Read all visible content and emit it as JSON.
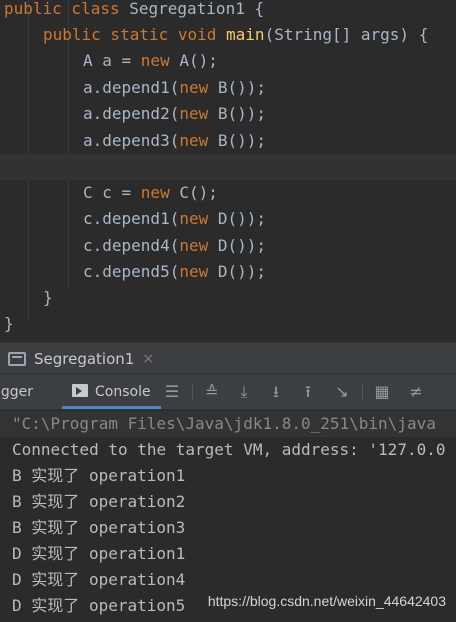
{
  "editor": {
    "lines": [
      {
        "kw1": "public class ",
        "t1": "Segregation1 {"
      },
      {
        "kw1": "public static void ",
        "fn": "main",
        "t1": "(String[] args) {"
      },
      {
        "t1": "A a = ",
        "kw1": "new ",
        "t2": "A();"
      },
      {
        "t1": "a.depend1(",
        "kw1": "new ",
        "t2": "B());"
      },
      {
        "t1": "a.depend2(",
        "kw1": "new ",
        "t2": "B());"
      },
      {
        "t1": "a.depend3(",
        "kw1": "new ",
        "t2": "B());"
      },
      {
        "t1": ""
      },
      {
        "t1": "C c = ",
        "kw1": "new ",
        "t2": "C();"
      },
      {
        "t1": "c.depend1(",
        "kw1": "new ",
        "t2": "D());"
      },
      {
        "t1": "c.depend4(",
        "kw1": "new ",
        "t2": "D());"
      },
      {
        "t1": "c.depend5(",
        "kw1": "new ",
        "t2": "D());"
      },
      {
        "t1": "}"
      },
      {
        "t1": "}"
      }
    ]
  },
  "run_tab": {
    "label": "Segregation1",
    "close": "×"
  },
  "toolbar": {
    "debugger_label": "ugger",
    "console_label": "Console"
  },
  "console": {
    "command": "\"C:\\Program Files\\Java\\jdk1.8.0_251\\bin\\java",
    "connected": "Connected to the target VM, address: '127.0.0",
    "outputs": [
      {
        "cls": "B",
        "verb": "实现了",
        "op": "operation1"
      },
      {
        "cls": "B",
        "verb": "实现了",
        "op": "operation2"
      },
      {
        "cls": "B",
        "verb": "实现了",
        "op": "operation3"
      },
      {
        "cls": "D",
        "verb": "实现了",
        "op": "operation1"
      },
      {
        "cls": "D",
        "verb": "实现了",
        "op": "operation4"
      },
      {
        "cls": "D",
        "verb": "实现了",
        "op": "operation5"
      }
    ]
  },
  "watermark": "https://blog.csdn.net/weixin_44642403",
  "colors": {
    "keyword": "#cc7832",
    "method": "#ffc66d",
    "text": "#a9b7c6",
    "background": "#2b2b2b",
    "accent": "#4a88c7"
  }
}
